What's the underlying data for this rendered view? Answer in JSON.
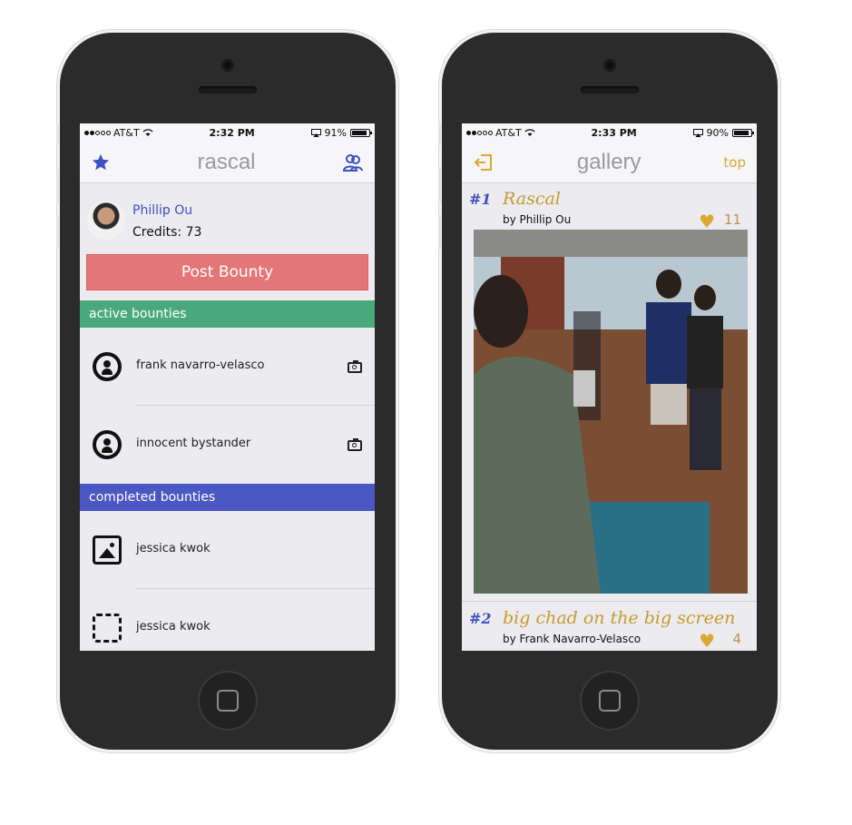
{
  "left_screen": {
    "status": {
      "carrier": "AT&T",
      "time": "2:32 PM",
      "battery": "91%",
      "battery_level": 0.91
    },
    "nav": {
      "title": "rascal",
      "left_icon": "star-icon",
      "right_icon": "users-icon"
    },
    "profile": {
      "name": "Phillip Ou",
      "credits": "Credits: 73"
    },
    "post_button": "Post Bounty",
    "sections": {
      "active": "active bounties",
      "completed": "completed bounties"
    },
    "active_bounties": [
      {
        "name": "frank navarro-velasco",
        "icon": "person-icon",
        "action_icon": "camera-icon"
      },
      {
        "name": "innocent bystander",
        "icon": "person-icon",
        "action_icon": "camera-icon"
      }
    ],
    "completed_bounties": [
      {
        "name": "jessica kwok",
        "icon": "image-icon"
      },
      {
        "name": "jessica kwok",
        "icon": "dashed-square-icon"
      }
    ],
    "colors": {
      "accent": "#3e4fc1",
      "post": "#e57677",
      "active": "#4aa97c",
      "completed": "#4b57c3"
    }
  },
  "right_screen": {
    "status": {
      "carrier": "AT&T",
      "time": "2:33 PM",
      "battery": "90%",
      "battery_level": 0.9
    },
    "nav": {
      "title": "gallery",
      "left_icon": "exit-icon",
      "right_label": "top"
    },
    "entries": [
      {
        "rank": "#1",
        "title": "Rascal",
        "by": "by Phillip Ou",
        "likes": "11"
      },
      {
        "rank": "#2",
        "title": "big chad on the big screen",
        "by": "by Frank Navarro-Velasco",
        "likes": "4"
      }
    ],
    "colors": {
      "gold": "#c59a2e",
      "heart": "#d8aa33"
    }
  }
}
